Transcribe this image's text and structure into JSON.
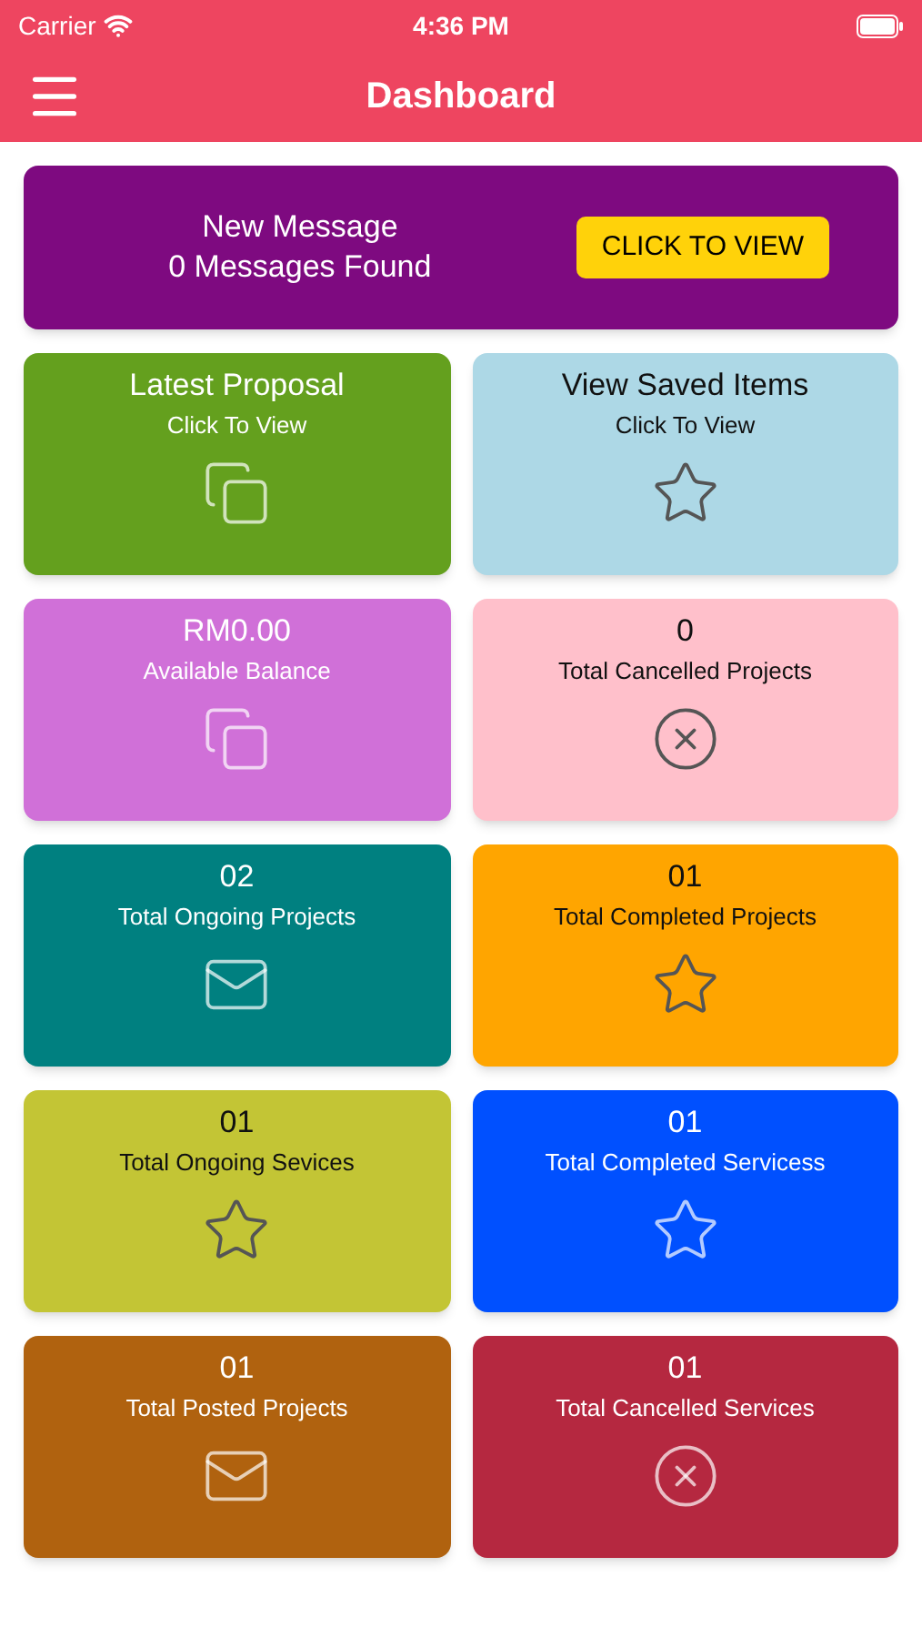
{
  "status_bar": {
    "carrier": "Carrier",
    "time": "4:36 PM"
  },
  "nav": {
    "title": "Dashboard"
  },
  "banner": {
    "title": "New Message",
    "subtitle": "0 Messages Found",
    "button": "CLICK TO VIEW"
  },
  "tiles": [
    {
      "title": "Latest Proposal",
      "subtitle": "Click To View",
      "color": "#64a01e"
    },
    {
      "title": "View Saved Items",
      "subtitle": "Click To View",
      "color": "#add8e6"
    },
    {
      "title": "RM0.00",
      "subtitle": "Available Balance",
      "color": "#d070d8"
    },
    {
      "title": "0",
      "subtitle": "Total Cancelled Projects",
      "color": "#ffc0cb"
    },
    {
      "title": "02",
      "subtitle": "Total Ongoing Projects",
      "color": "#008080"
    },
    {
      "title": "01",
      "subtitle": "Total Completed Projects",
      "color": "#ffa500"
    },
    {
      "title": "01",
      "subtitle": "Total Ongoing Sevices",
      "color": "#c3c535"
    },
    {
      "title": "01",
      "subtitle": "Total Completed Servicess",
      "color": "#0050ff"
    },
    {
      "title": "01",
      "subtitle": "Total Posted Projects",
      "color": "#b0620f"
    },
    {
      "title": "01",
      "subtitle": "Total Cancelled Services",
      "color": "#b52840"
    }
  ]
}
